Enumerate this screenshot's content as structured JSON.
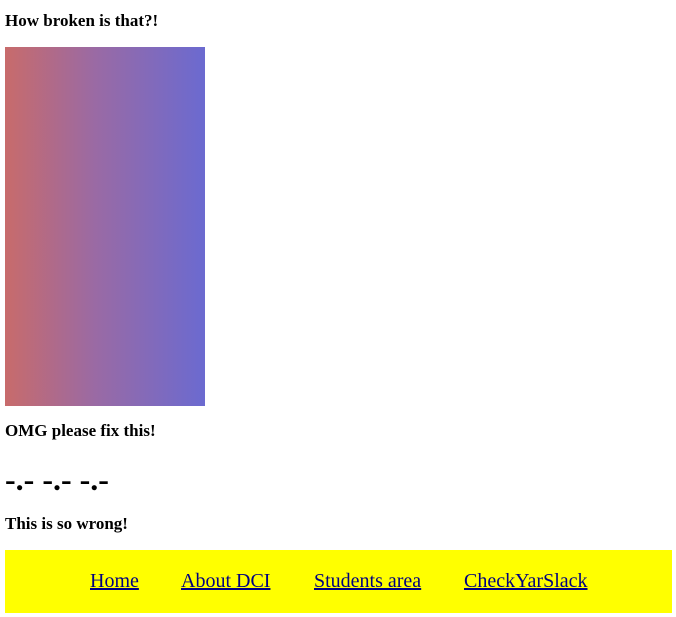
{
  "headings": {
    "top": "How broken is that?!",
    "omg": "OMG please fix this!",
    "emoticons": "-.- -.- -.-",
    "wrong": "This is so wrong!"
  },
  "gradient": {
    "start_color": "#c86b6b",
    "end_color": "#6b6ad0"
  },
  "nav": {
    "background": "#ffff00",
    "items": [
      {
        "label": "Home"
      },
      {
        "label": "About DCI"
      },
      {
        "label": "Students area"
      },
      {
        "label": "CheckYarSlack"
      }
    ]
  }
}
